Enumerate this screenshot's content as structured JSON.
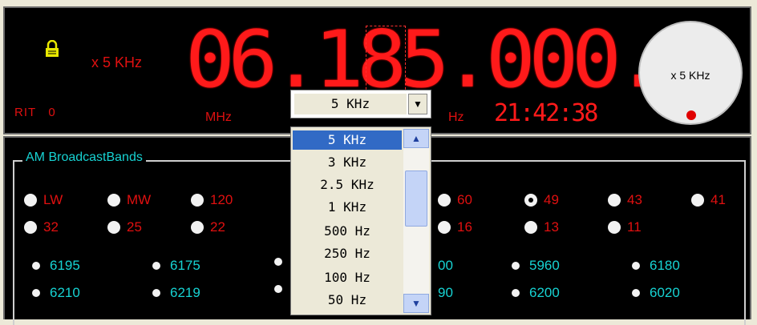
{
  "display": {
    "step_label": "x 5 KHz",
    "rit_label": "RIT",
    "rit_value": "0",
    "frequency": "06.185.000.0",
    "mhz_unit": "MHz",
    "hz_unit": "Hz",
    "clock": "21:42:38",
    "knob_label": "x 5 KHz"
  },
  "step_select": {
    "value": "5 KHz",
    "options": [
      "5 KHz",
      "3 KHz",
      "2.5 KHz",
      "1 KHz",
      "500 Hz",
      "250 Hz",
      "100 Hz",
      "50 Hz"
    ],
    "selected_index": 0
  },
  "bands": {
    "group_title": "AM BroadcastBands",
    "row1": [
      "LW",
      "MW",
      "120",
      "60",
      "49",
      "43",
      "41"
    ],
    "row2": [
      "32",
      "25",
      "22",
      "16",
      "13",
      "11"
    ],
    "selected": "49",
    "stations_row1": [
      "6195",
      "6175",
      "00",
      "5960",
      "6180"
    ],
    "stations_row2": [
      "6210",
      "6219",
      "90",
      "6200",
      "6020"
    ]
  },
  "colors": {
    "display_red": "#ff1a1a",
    "station_cyan": "#17d3d3",
    "selection_blue": "#316ac5"
  }
}
